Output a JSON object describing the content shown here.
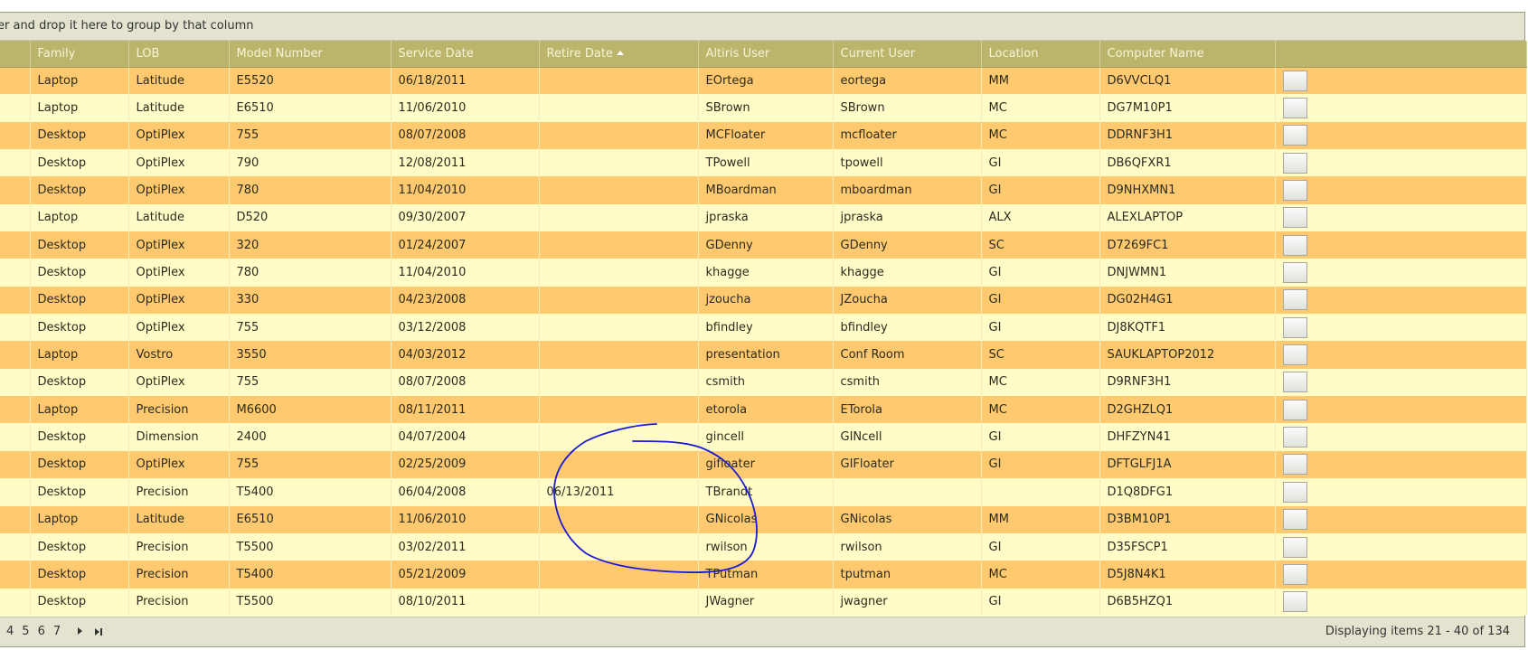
{
  "group_bar": {
    "text": "er and drop it here to group by that column"
  },
  "columns": [
    {
      "key": "c0",
      "label": ""
    },
    {
      "key": "family",
      "label": "Family"
    },
    {
      "key": "lob",
      "label": "LOB"
    },
    {
      "key": "model",
      "label": "Model Number"
    },
    {
      "key": "service",
      "label": "Service Date"
    },
    {
      "key": "retire",
      "label": "Retire Date",
      "sorted": "asc"
    },
    {
      "key": "altiris",
      "label": "Altiris User"
    },
    {
      "key": "current",
      "label": "Current User"
    },
    {
      "key": "location",
      "label": "Location"
    },
    {
      "key": "computer",
      "label": "Computer Name"
    },
    {
      "key": "action",
      "label": ""
    }
  ],
  "rows": [
    [
      "Laptop",
      "Latitude",
      "E5520",
      "06/18/2011",
      "",
      "EOrtega",
      "eortega",
      "MM",
      "D6VVCLQ1"
    ],
    [
      "Laptop",
      "Latitude",
      "E6510",
      "11/06/2010",
      "",
      "SBrown",
      "SBrown",
      "MC",
      "DG7M10P1"
    ],
    [
      "Desktop",
      "OptiPlex",
      "755",
      "08/07/2008",
      "",
      "MCFloater",
      "mcfloater",
      "MC",
      "DDRNF3H1"
    ],
    [
      "Desktop",
      "OptiPlex",
      "790",
      "12/08/2011",
      "",
      "TPowell",
      "tpowell",
      "GI",
      "DB6QFXR1"
    ],
    [
      "Desktop",
      "OptiPlex",
      "780",
      "11/04/2010",
      "",
      "MBoardman",
      "mboardman",
      "GI",
      "D9NHXMN1"
    ],
    [
      "Laptop",
      "Latitude",
      "D520",
      "09/30/2007",
      "",
      "jpraska",
      "jpraska",
      "ALX",
      "ALEXLAPTOP"
    ],
    [
      "Desktop",
      "OptiPlex",
      "320",
      "01/24/2007",
      "",
      "GDenny",
      "GDenny",
      "SC",
      "D7269FC1"
    ],
    [
      "Desktop",
      "OptiPlex",
      "780",
      "11/04/2010",
      "",
      "khagge",
      "khagge",
      "GI",
      "DNJWMN1"
    ],
    [
      "Desktop",
      "OptiPlex",
      "330",
      "04/23/2008",
      "",
      "jzoucha",
      "JZoucha",
      "GI",
      "DG02H4G1"
    ],
    [
      "Desktop",
      "OptiPlex",
      "755",
      "03/12/2008",
      "",
      "bfindley",
      "bfindley",
      "GI",
      "DJ8KQTF1"
    ],
    [
      "Laptop",
      "Vostro",
      "3550",
      "04/03/2012",
      "",
      "presentation",
      "Conf Room",
      "SC",
      "SAUKLAPTOP2012"
    ],
    [
      "Desktop",
      "OptiPlex",
      "755",
      "08/07/2008",
      "",
      "csmith",
      "csmith",
      "MC",
      "D9RNF3H1"
    ],
    [
      "Laptop",
      "Precision",
      "M6600",
      "08/11/2011",
      "",
      "etorola",
      "ETorola",
      "MC",
      "D2GHZLQ1"
    ],
    [
      "Desktop",
      "Dimension",
      "2400",
      "04/07/2004",
      "",
      "gincell",
      "GINcell",
      "GI",
      "DHFZYN41"
    ],
    [
      "Desktop",
      "OptiPlex",
      "755",
      "02/25/2009",
      "",
      "gifloater",
      "GIFloater",
      "GI",
      "DFTGLFJ1A"
    ],
    [
      "Desktop",
      "Precision",
      "T5400",
      "06/04/2008",
      "06/13/2011",
      "TBrandt",
      "",
      "",
      "D1Q8DFG1"
    ],
    [
      "Laptop",
      "Latitude",
      "E6510",
      "11/06/2010",
      "",
      "GNicolas",
      "GNicolas",
      "MM",
      "D3BM10P1"
    ],
    [
      "Desktop",
      "Precision",
      "T5500",
      "03/02/2011",
      "",
      "rwilson",
      "rwilson",
      "GI",
      "D35FSCP1"
    ],
    [
      "Desktop",
      "Precision",
      "T5400",
      "05/21/2009",
      "",
      "TPutman",
      "tputman",
      "MC",
      "D5J8N4K1"
    ],
    [
      "Desktop",
      "Precision",
      "T5500",
      "08/10/2011",
      "",
      "JWagner",
      "jwagner",
      "GI",
      "D6B5HZQ1"
    ]
  ],
  "pager": {
    "pages": [
      "4",
      "5",
      "6",
      "7"
    ],
    "next_icon": "next-page-icon",
    "last_icon": "last-page-icon",
    "info": "Displaying items 21 - 40 of 134"
  },
  "colors": {
    "header_bg": "#bab56b",
    "row_odd": "#ffc96f",
    "row_even": "#fffcc8",
    "annotation": "#1a1ad6"
  }
}
